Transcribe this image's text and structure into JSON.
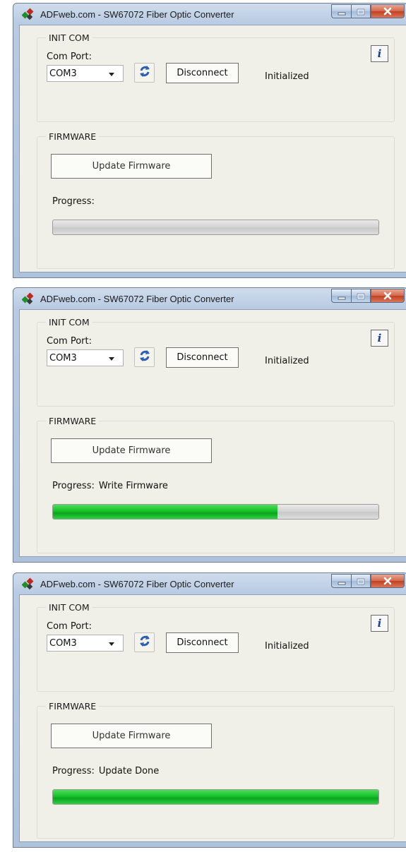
{
  "windows": [
    {
      "title": "ADFweb.com - SW67072 Fiber Optic Converter",
      "init_com": {
        "group_label": "INIT COM",
        "com_port_label": "Com Port:",
        "com_port_value": "COM3",
        "disconnect_label": "Disconnect",
        "status": "Initialized"
      },
      "firmware": {
        "group_label": "FIRMWARE",
        "update_button_label": "Update Firmware",
        "progress_label": "Progress:",
        "progress_status": "",
        "progress_fraction": 0.0
      }
    },
    {
      "title": "ADFweb.com - SW67072 Fiber Optic Converter",
      "init_com": {
        "group_label": "INIT COM",
        "com_port_label": "Com Port:",
        "com_port_value": "COM3",
        "disconnect_label": "Disconnect",
        "status": "Initialized"
      },
      "firmware": {
        "group_label": "FIRMWARE",
        "update_button_label": "Update Firmware",
        "progress_label": "Progress:",
        "progress_status": "Write Firmware",
        "progress_fraction": 0.69
      }
    },
    {
      "title": "ADFweb.com - SW67072 Fiber Optic Converter",
      "init_com": {
        "group_label": "INIT COM",
        "com_port_label": "Com Port:",
        "com_port_value": "COM3",
        "disconnect_label": "Disconnect",
        "status": "Initialized"
      },
      "firmware": {
        "group_label": "FIRMWARE",
        "update_button_label": "Update Firmware",
        "progress_label": "Progress:",
        "progress_status": "Update Done",
        "progress_fraction": 1.0
      }
    }
  ],
  "icons": {
    "app": "adfweb-logo-icon",
    "refresh": "refresh-icon",
    "info": "info-icon",
    "minimize": "minimize-icon",
    "maximize": "maximize-icon",
    "close": "close-icon"
  },
  "colors": {
    "progress_fill": "#17c12a",
    "progress_track": "#d5d5d5",
    "close_button": "#c2401f",
    "info_glyph": "#1d3f8f"
  }
}
